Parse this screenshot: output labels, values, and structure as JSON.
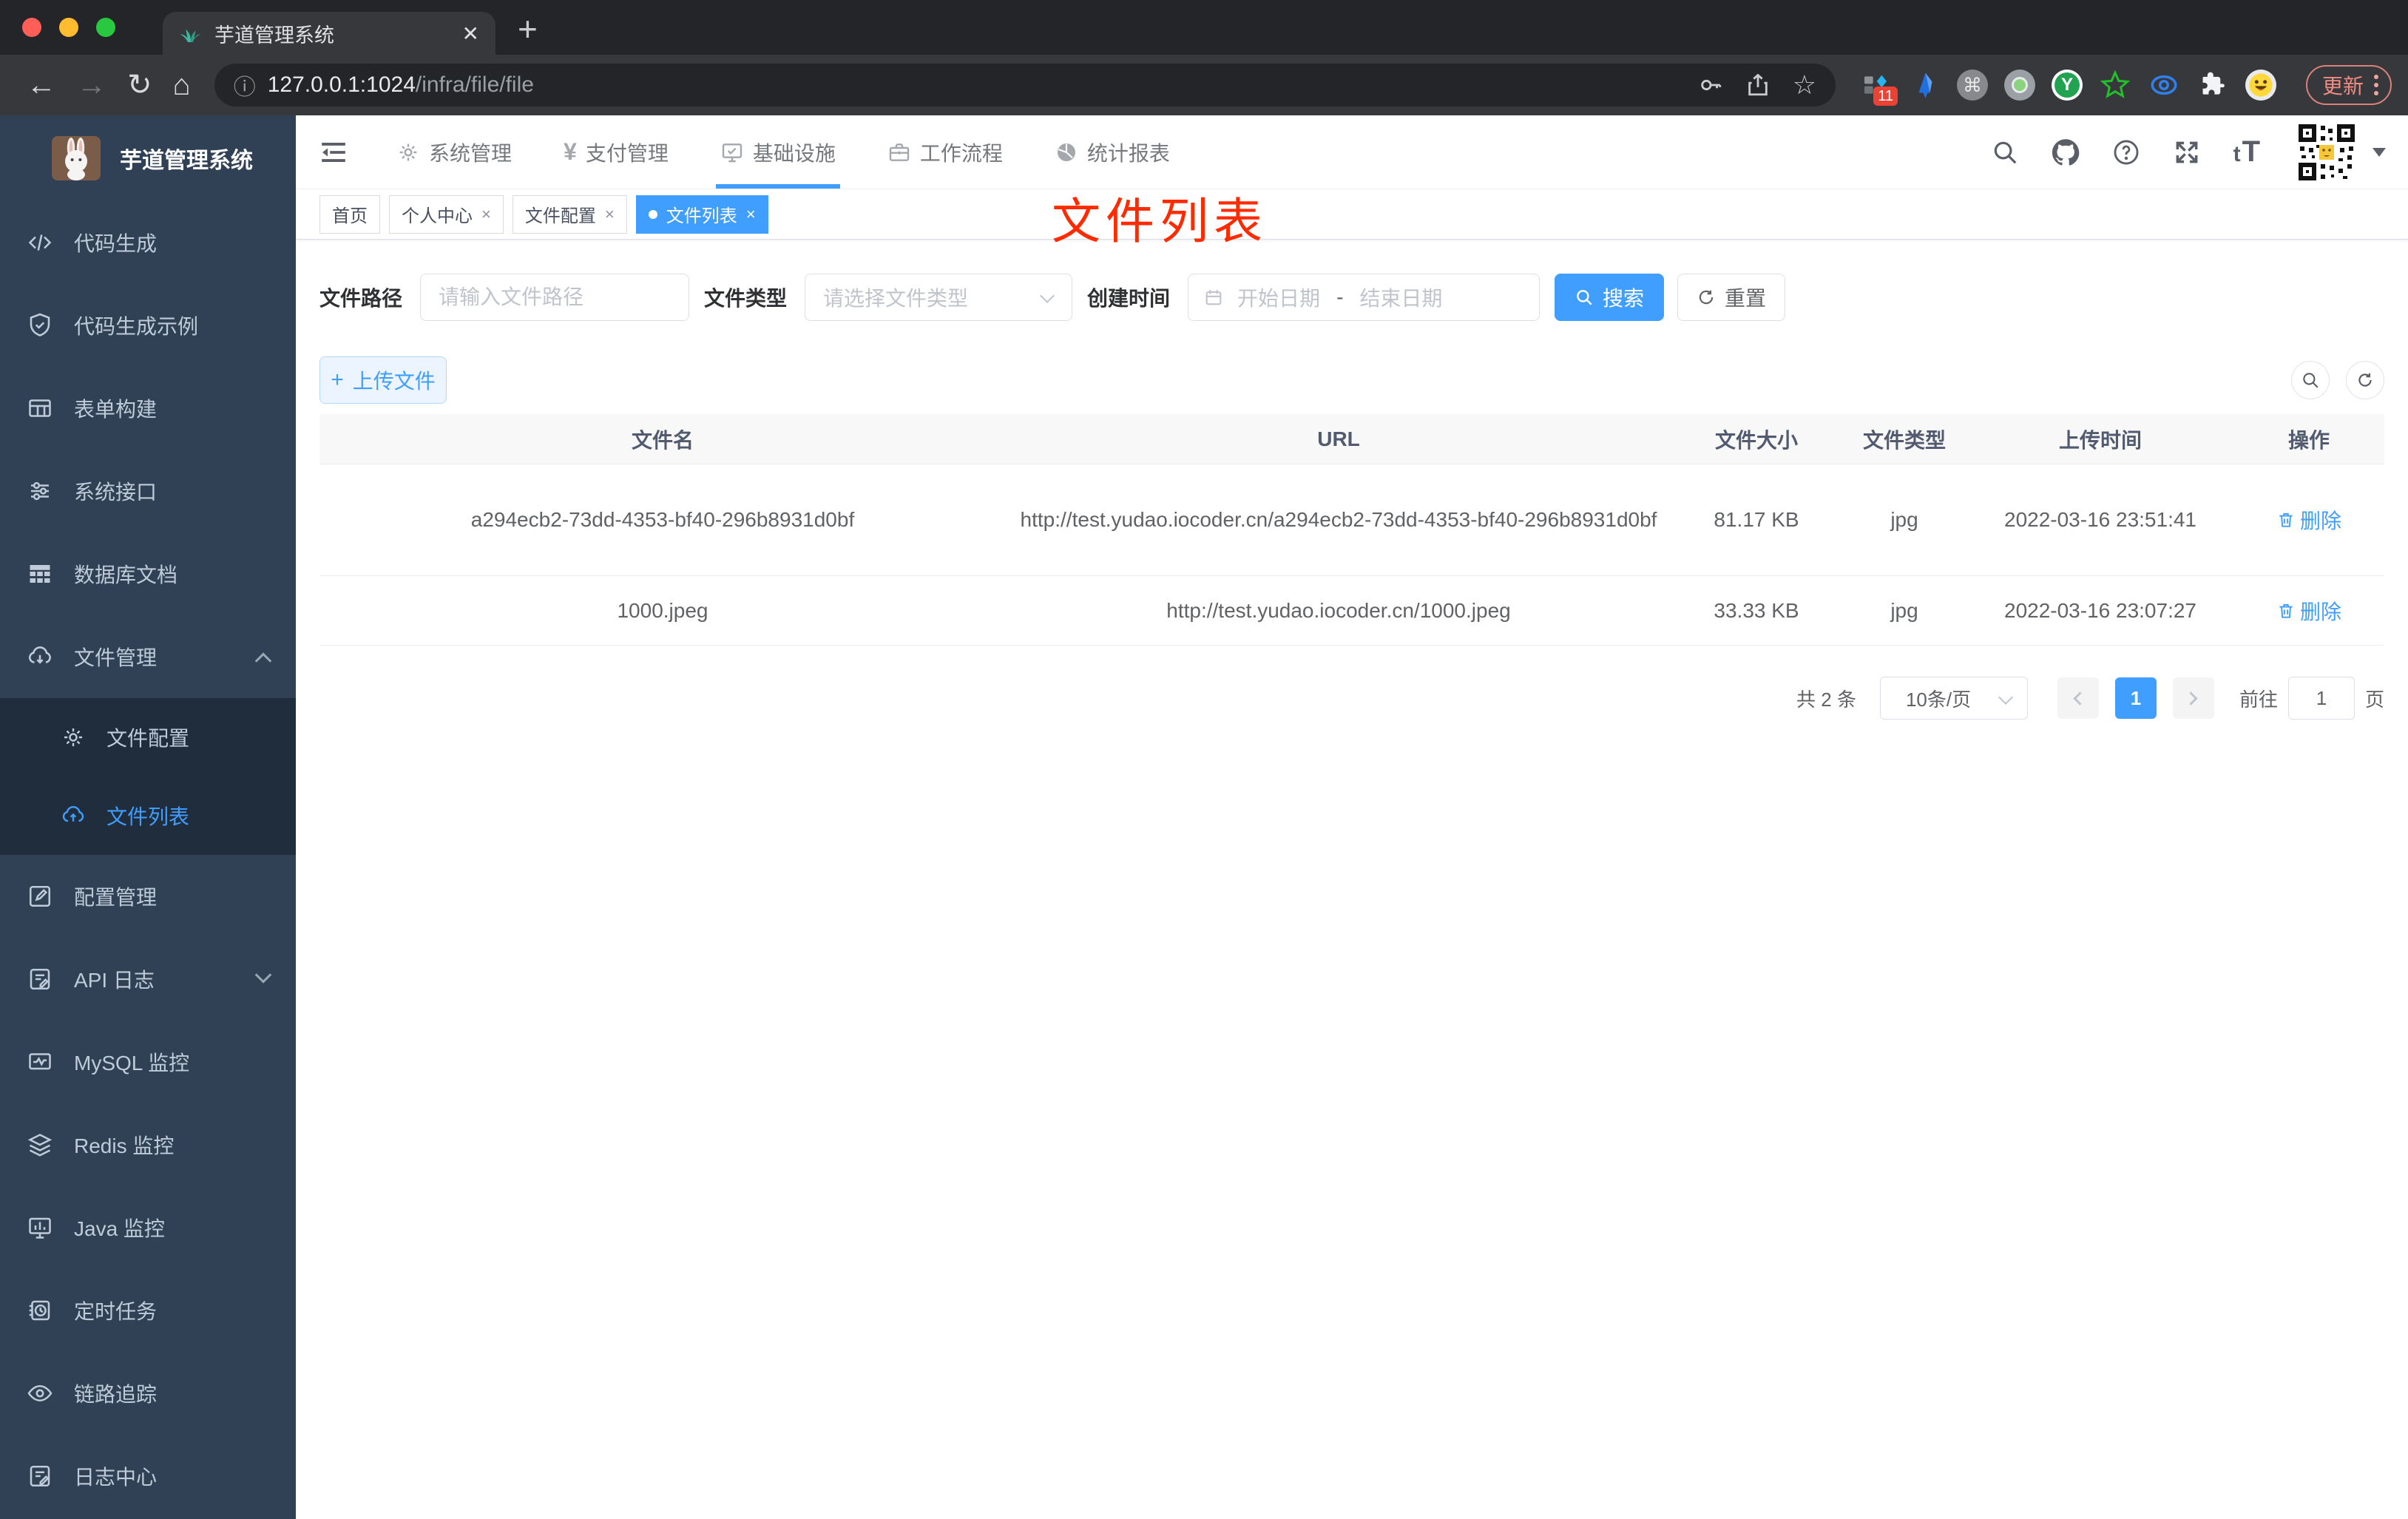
{
  "browser": {
    "tab_title": "芋道管理系统",
    "url_host": "127.0.0.1:1024",
    "url_path": "/infra/file/file",
    "ext_badge": "11",
    "update_label": "更新"
  },
  "icons": {
    "close": "✕",
    "tag_close": "×",
    "plus": "+",
    "back": "←",
    "forward": "→",
    "reload": "↻",
    "home": "⌂",
    "info": "ⓘ",
    "star": "☆",
    "cmd": "⌘",
    "yen": "¥",
    "font_small": "t",
    "font_big": "T",
    "y_letter": "Y"
  },
  "sidebar": {
    "title": "芋道管理系统",
    "items": [
      {
        "label": "代码生成"
      },
      {
        "label": "代码生成示例"
      },
      {
        "label": "表单构建"
      },
      {
        "label": "系统接口"
      },
      {
        "label": "数据库文档"
      },
      {
        "label": "文件管理"
      },
      {
        "label": "配置管理"
      },
      {
        "label": "API 日志"
      },
      {
        "label": "MySQL 监控"
      },
      {
        "label": "Redis 监控"
      },
      {
        "label": "Java 监控"
      },
      {
        "label": "定时任务"
      },
      {
        "label": "链路追踪"
      },
      {
        "label": "日志中心"
      }
    ],
    "submenu": [
      {
        "label": "文件配置"
      },
      {
        "label": "文件列表"
      }
    ]
  },
  "topnav": {
    "menus": [
      {
        "label": "系统管理"
      },
      {
        "label": "支付管理"
      },
      {
        "label": "基础设施"
      },
      {
        "label": "工作流程"
      },
      {
        "label": "统计报表"
      }
    ]
  },
  "tags": [
    {
      "label": "首页"
    },
    {
      "label": "个人中心"
    },
    {
      "label": "文件配置"
    },
    {
      "label": "文件列表"
    }
  ],
  "annotation": "文件列表",
  "filters": {
    "path_label": "文件路径",
    "path_placeholder": "请输入文件路径",
    "type_label": "文件类型",
    "type_placeholder": "请选择文件类型",
    "date_label": "创建时间",
    "date_start_placeholder": "开始日期",
    "date_separator": "-",
    "date_end_placeholder": "结束日期",
    "search_label": "搜索",
    "reset_label": "重置"
  },
  "toolbar": {
    "upload_label": "上传文件"
  },
  "table": {
    "columns": [
      "文件名",
      "URL",
      "文件大小",
      "文件类型",
      "上传时间",
      "操作"
    ],
    "rows": [
      {
        "name": "a294ecb2-73dd-4353-bf40-296b8931d0bf",
        "url": "http://test.yudao.iocoder.cn/a294ecb2-73dd-4353-bf40-296b8931d0bf",
        "size": "81.17 KB",
        "type": "jpg",
        "time": "2022-03-16 23:51:41",
        "action": "删除"
      },
      {
        "name": "1000.jpeg",
        "url": "http://test.yudao.iocoder.cn/1000.jpeg",
        "size": "33.33 KB",
        "type": "jpg",
        "time": "2022-03-16 23:07:27",
        "action": "删除"
      }
    ]
  },
  "pagination": {
    "total": "共 2 条",
    "page_size": "10条/页",
    "page": "1",
    "goto_label": "前往",
    "goto_value": "1",
    "page_suffix": "页"
  },
  "colors": {
    "accent": "#409eff",
    "annotation_red": "#ff2b00",
    "sidebar_bg": "#304156",
    "submenu_bg": "#1f2d3d"
  }
}
